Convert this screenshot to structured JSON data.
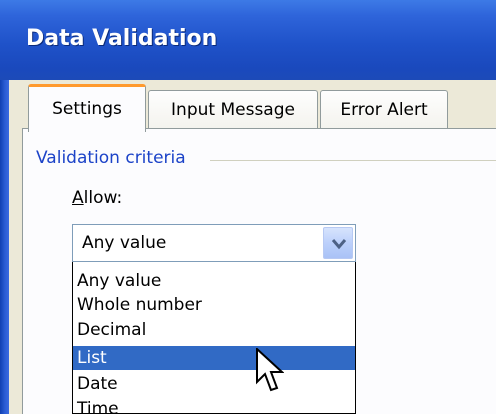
{
  "window": {
    "title": "Data Validation"
  },
  "tabs": [
    {
      "label": "Settings",
      "active": true
    },
    {
      "label": "Input Message",
      "active": false
    },
    {
      "label": "Error Alert",
      "active": false
    }
  ],
  "settings": {
    "group_label": "Validation criteria",
    "allow_label_underlined": "A",
    "allow_label_rest": "llow:",
    "allow_value": "Any value",
    "allow_options": [
      "Any value",
      "Whole number",
      "Decimal",
      "List",
      "Date",
      "Time"
    ],
    "highlighted_option": "List"
  },
  "colors": {
    "title_bar": "#1f52c9",
    "selection": "#316ac5",
    "group_label": "#1c43c8",
    "active_tab_accent": "#ff9a2e"
  },
  "icons": {
    "dropdown_arrow": "chevron-down-icon",
    "mouse_pointer": "arrow-cursor-icon"
  }
}
